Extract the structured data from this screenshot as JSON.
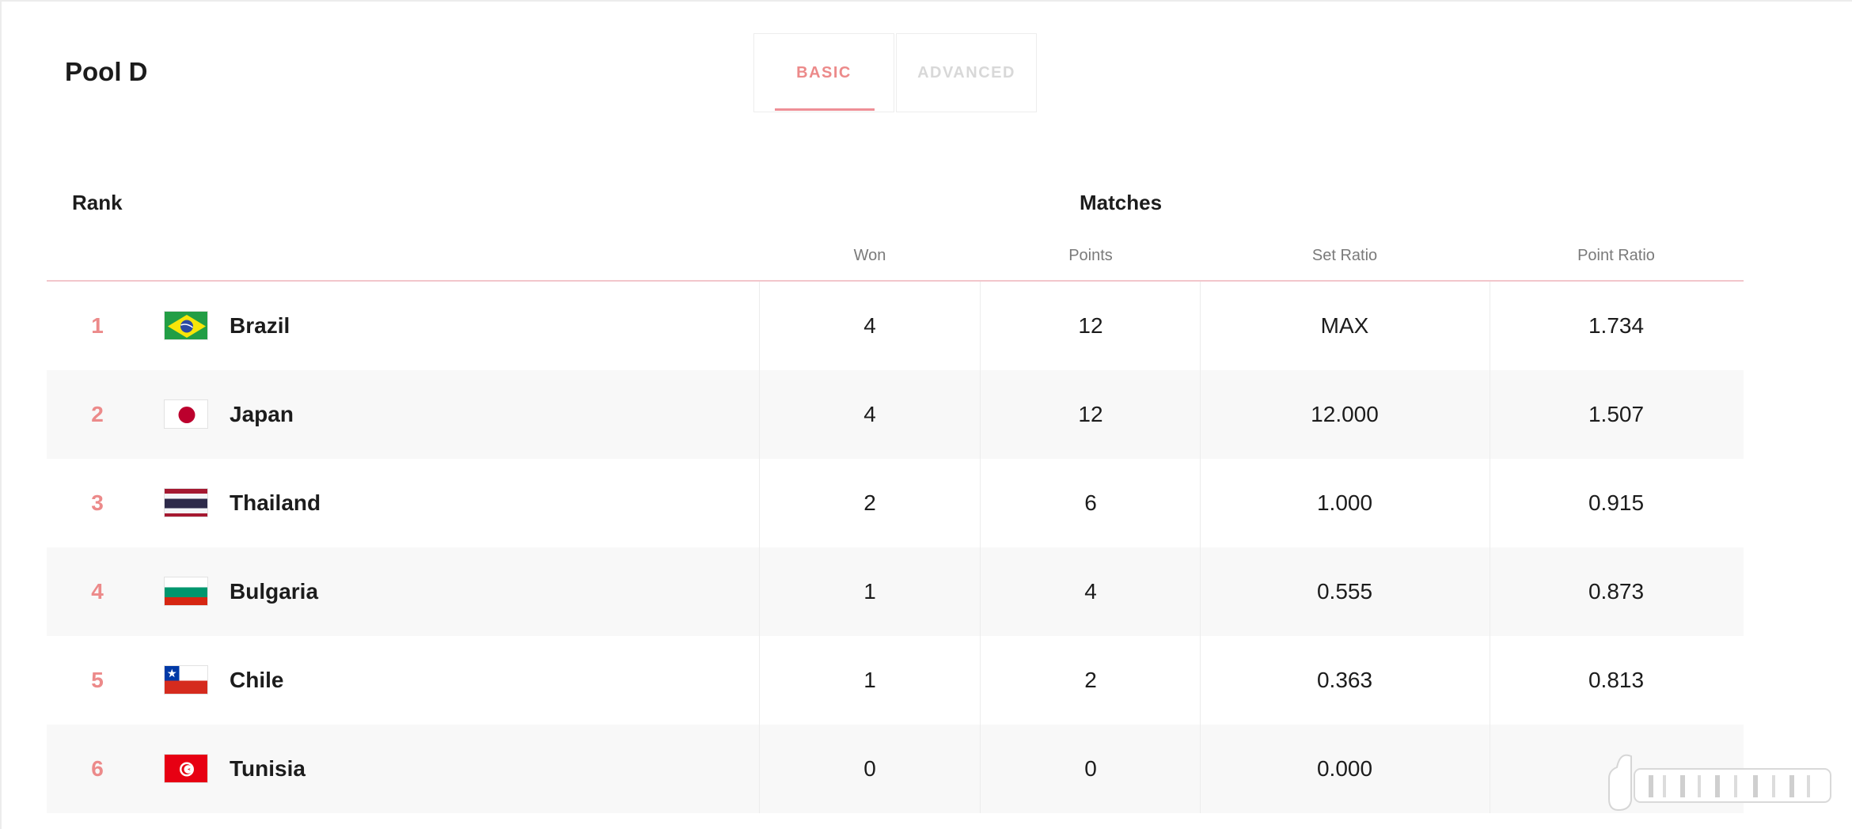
{
  "header": {
    "title": "Pool D"
  },
  "tabs": [
    {
      "label": "BASIC",
      "active": true
    },
    {
      "label": "ADVANCED",
      "active": false
    }
  ],
  "table": {
    "rank_header": "Rank",
    "group_header": "Matches",
    "columns": [
      "Won",
      "Points",
      "Set Ratio",
      "Point Ratio"
    ],
    "rows": [
      {
        "rank": "1",
        "team": "Brazil",
        "flag": "brazil-flag-icon",
        "won": "4",
        "points": "12",
        "set_ratio": "MAX",
        "point_ratio": "1.734"
      },
      {
        "rank": "2",
        "team": "Japan",
        "flag": "japan-flag-icon",
        "won": "4",
        "points": "12",
        "set_ratio": "12.000",
        "point_ratio": "1.507"
      },
      {
        "rank": "3",
        "team": "Thailand",
        "flag": "thailand-flag-icon",
        "won": "2",
        "points": "6",
        "set_ratio": "1.000",
        "point_ratio": "0.915"
      },
      {
        "rank": "4",
        "team": "Bulgaria",
        "flag": "bulgaria-flag-icon",
        "won": "1",
        "points": "4",
        "set_ratio": "0.555",
        "point_ratio": "0.873"
      },
      {
        "rank": "5",
        "team": "Chile",
        "flag": "chile-flag-icon",
        "won": "1",
        "points": "2",
        "set_ratio": "0.363",
        "point_ratio": "0.813"
      },
      {
        "rank": "6",
        "team": "Tunisia",
        "flag": "tunisia-flag-icon",
        "won": "0",
        "points": "0",
        "set_ratio": "0.000",
        "point_ratio": ""
      }
    ]
  },
  "colors": {
    "accent": "#ec8a8a",
    "header_rule": "#f2c6cb",
    "alt_row": "#f8f8f8"
  }
}
